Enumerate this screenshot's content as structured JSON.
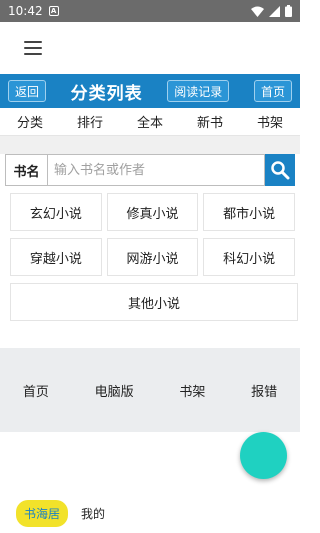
{
  "status": {
    "time": "10:42",
    "badge": "A"
  },
  "header": {
    "back_label": "返回",
    "title": "分类列表",
    "history_label": "阅读记录",
    "home_label": "首页"
  },
  "nav": [
    "分类",
    "排行",
    "全本",
    "新书",
    "书架"
  ],
  "search": {
    "label": "书名",
    "placeholder": "输入书名或作者"
  },
  "categories": {
    "row1": [
      "玄幻小说",
      "修真小说",
      "都市小说"
    ],
    "row2": [
      "穿越小说",
      "网游小说",
      "科幻小说"
    ],
    "other": "其他小说"
  },
  "footer": [
    "首页",
    "电脑版",
    "书架",
    "报错"
  ],
  "bottom": {
    "site_label": "书海居",
    "mine_label": "我的"
  },
  "colors": {
    "primary": "#1a82c4",
    "fab": "#1fd1c1",
    "pill": "#f2e22a",
    "statusbar": "#6b6b6b"
  }
}
